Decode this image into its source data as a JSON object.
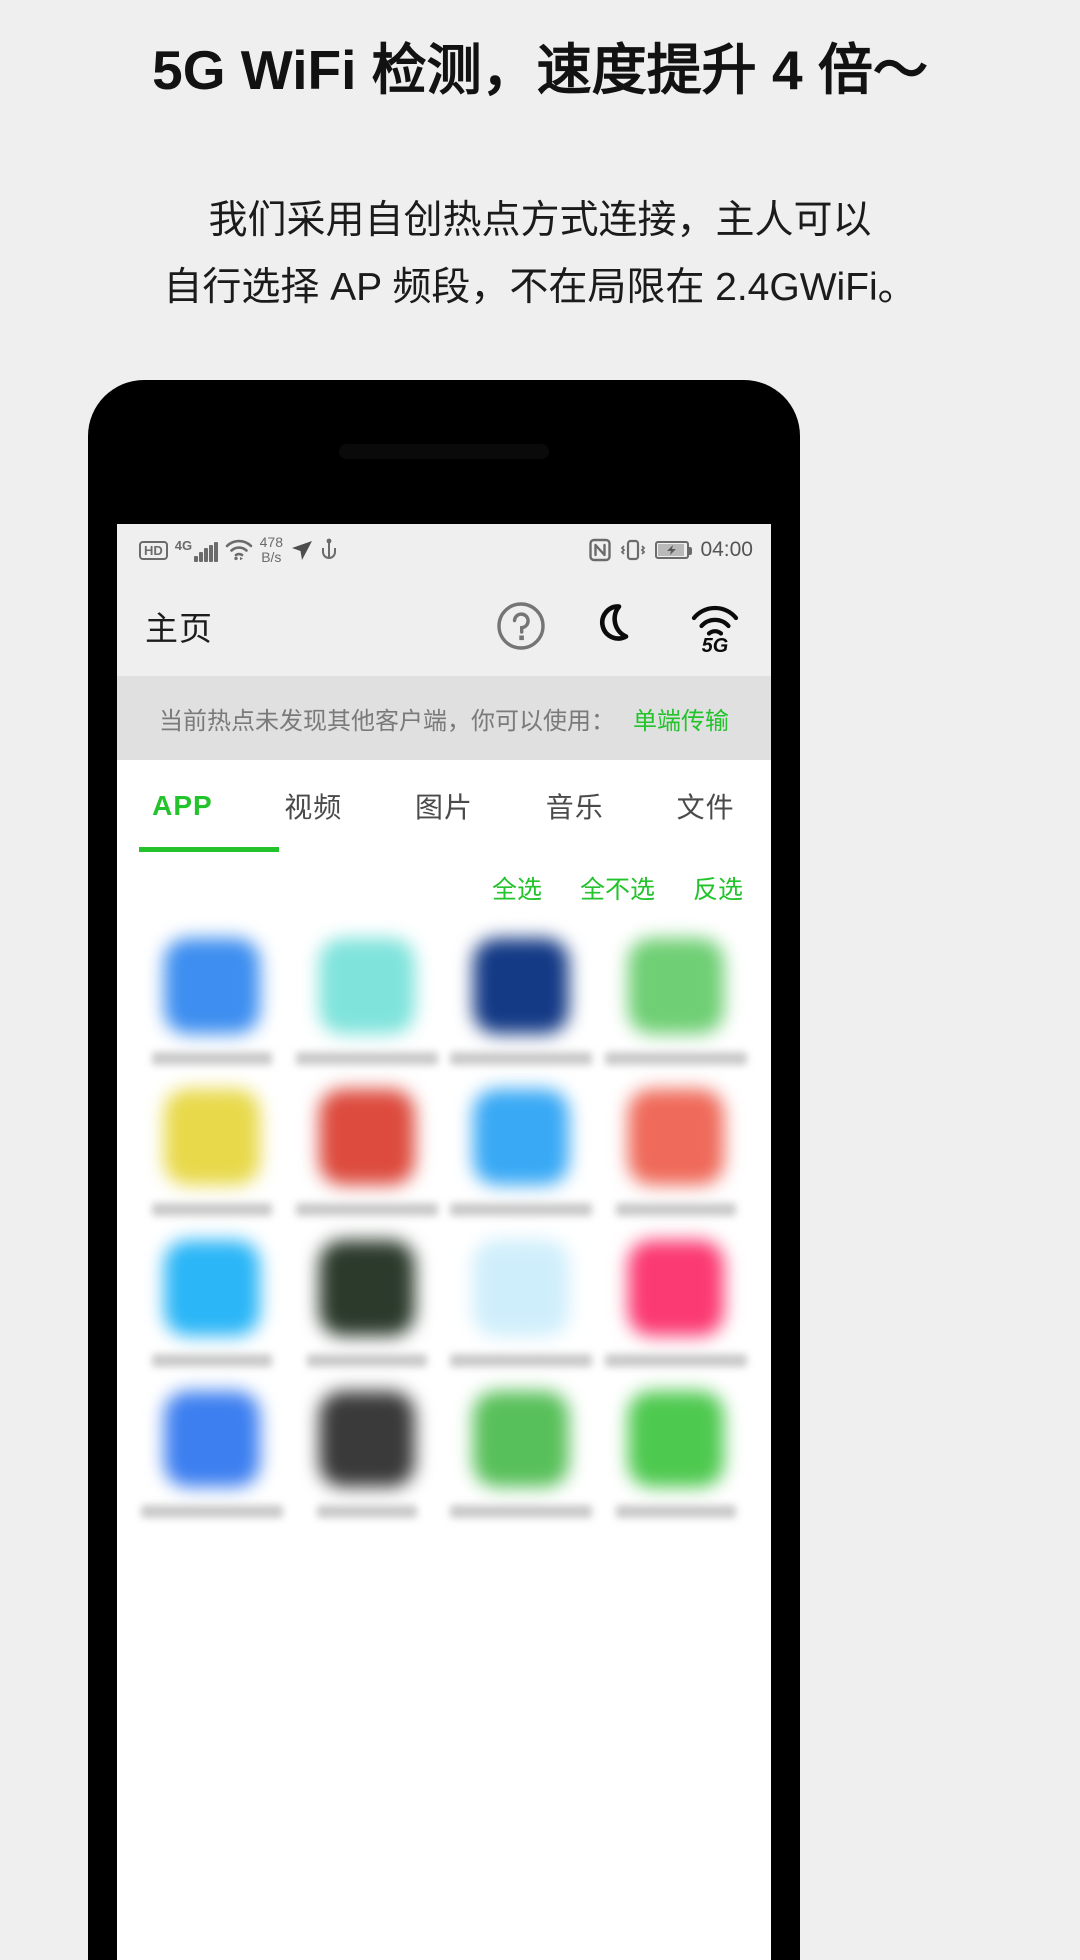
{
  "promo": {
    "title": "5G WiFi 检测，速度提升 4 倍～",
    "subtitle_line1": "我们采用自创热点方式连接，主人可以",
    "subtitle_line2": "自行选择 AP 频段，不在局限在 2.4GWiFi。"
  },
  "statusbar": {
    "hd_badge": "HD",
    "network_label": "4G",
    "speed_value": "478",
    "speed_unit": "B/s",
    "time": "04:00",
    "icons": [
      "hd-icon",
      "signal-bars-icon",
      "wifi-icon",
      "location-arrow-icon",
      "usb-icon",
      "nfc-icon",
      "vibrate-icon",
      "battery-charging-icon"
    ]
  },
  "appbar": {
    "title": "主页",
    "actions": [
      {
        "name": "help-icon",
        "label": "帮助"
      },
      {
        "name": "moon-icon",
        "label": "夜间模式"
      },
      {
        "name": "wifi-5g-icon",
        "label": "5G"
      }
    ],
    "wifi_5g_label": "5G"
  },
  "notice": {
    "text": "当前热点未发现其他客户端，你可以使用：",
    "action": "单端传输"
  },
  "tabs": [
    {
      "label": "APP",
      "active": true
    },
    {
      "label": "视频",
      "active": false
    },
    {
      "label": "图片",
      "active": false
    },
    {
      "label": "音乐",
      "active": false
    },
    {
      "label": "文件",
      "active": false
    }
  ],
  "select_actions": [
    {
      "label": "全选"
    },
    {
      "label": "全不选"
    },
    {
      "label": "反选"
    }
  ],
  "colors": {
    "accent_green": "#22c32b",
    "page_background": "#efefef",
    "notice_background": "#e0e0e0",
    "phone_frame": "#000000"
  },
  "app_grid": [
    {
      "color": "#3d8ef0",
      "label_width": "w1"
    },
    {
      "color": "#7fe3dc",
      "label_width": "w2"
    },
    {
      "color": "#143a86",
      "label_width": "w2"
    },
    {
      "color": "#6fcf74",
      "label_width": "w2"
    },
    {
      "color": "#e8d94a",
      "label_width": "w1"
    },
    {
      "color": "#dd4b3e",
      "label_width": "w2"
    },
    {
      "color": "#39a9f5",
      "label_width": "w2"
    },
    {
      "color": "#ef6a5a",
      "label_width": "w1"
    },
    {
      "color": "#2bb6f7",
      "label_width": "w1"
    },
    {
      "color": "#2c3a2c",
      "label_width": "w1"
    },
    {
      "color": "#cfeefb",
      "label_width": "w2"
    },
    {
      "color": "#fb3a73",
      "label_width": "w2"
    },
    {
      "color": "#3d7ff0",
      "label_width": "w2"
    },
    {
      "color": "#3a3a3a",
      "label_width": "w3"
    },
    {
      "color": "#58c05a",
      "label_width": "w2"
    },
    {
      "color": "#4ec94f",
      "label_width": "w1"
    }
  ]
}
